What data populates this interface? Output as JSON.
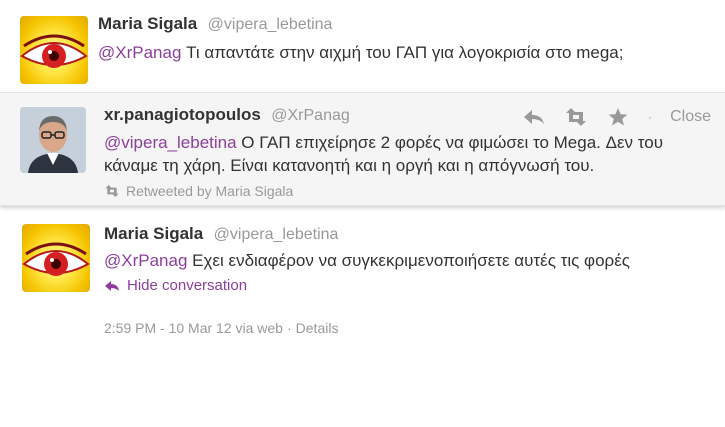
{
  "colors": {
    "link_purple": "#8c3f9a",
    "muted_gray": "#999999",
    "text_dark": "#333333",
    "highlight_bg": "#f5f5f5"
  },
  "tweets": [
    {
      "fullname": "Maria Sigala",
      "screenname": "@vipera_lebetina",
      "mention": "@XrPanag",
      "body": " Τι απαντάτε στην αιχμή του ΓΑΠ για λογοκρισία στο mega;",
      "avatar_icon": "eye-avatar"
    },
    {
      "fullname": "xr.panagiotopoulos",
      "screenname": "@XrPanag",
      "mention": "@vipera_lebetina",
      "body": " Ο ΓΑΠ επιχείρησε 2 φορές να φιμώσει το Mega. Δεν του κάναμε τη χάρη. Είναι κατανοητή και η οργή και η απόγνωσή του.",
      "retweeted_by": "Retweeted by Maria Sigala",
      "actions": {
        "reply_icon": "reply-icon",
        "retweet_icon": "retweet-icon",
        "favorite_icon": "star-icon",
        "separator": "·",
        "close_label": "Close"
      },
      "avatar_icon": "man-avatar"
    },
    {
      "fullname": "Maria Sigala",
      "screenname": "@vipera_lebetina",
      "mention": "@XrPanag",
      "body": " Εχει ενδιαφέρον να συγκεκριμενοποιήσετε αυτές τις φορές",
      "hide_conversation": "Hide conversation",
      "meta": {
        "time": "2:59 PM - 10 Mar 12 via web",
        "separator": "·",
        "details": "Details"
      },
      "avatar_icon": "eye-avatar"
    }
  ]
}
